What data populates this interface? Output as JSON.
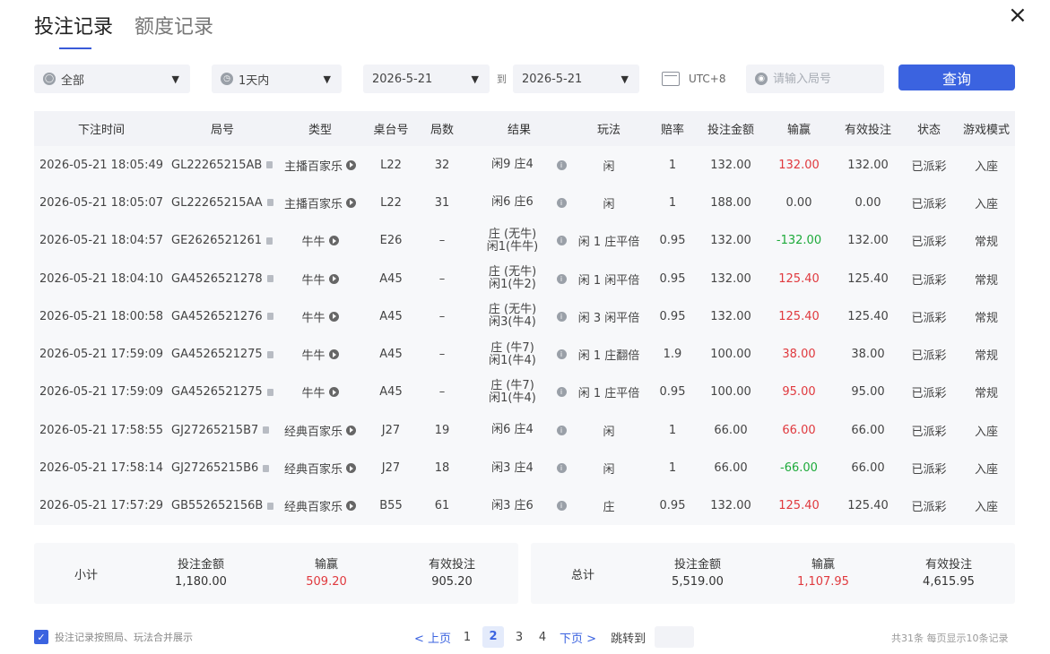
{
  "tabs": [
    {
      "label": "投注记录",
      "active": true
    },
    {
      "label": "额度记录",
      "active": false
    }
  ],
  "close_icon": "×",
  "filters": {
    "category": "全部",
    "time_range": "1天内",
    "date_from": "2026-5-21",
    "to_label": "到",
    "date_to": "2026-5-21",
    "timezone": "UTC+8",
    "search_placeholder": "请输入局号",
    "query_button": "查询"
  },
  "columns": [
    "下注时间",
    "局号",
    "类型",
    "桌台号",
    "局数",
    "结果",
    "玩法",
    "赔率",
    "投注金额",
    "输赢",
    "有效投注",
    "状态",
    "游戏模式"
  ],
  "rows": [
    {
      "time": "2026-05-21 18:05:49",
      "id": "GL22265215AB",
      "type": "主播百家乐",
      "table": "L22",
      "round": "32",
      "result_1": "闲9 庄4",
      "result_2": "",
      "play": "闲",
      "odds": "1",
      "amount": "132.00",
      "win": "132.00",
      "win_color": "red",
      "valid": "132.00",
      "status": "已派彩",
      "mode": "入座"
    },
    {
      "time": "2026-05-21 18:05:07",
      "id": "GL22265215AA",
      "type": "主播百家乐",
      "table": "L22",
      "round": "31",
      "result_1": "闲6 庄6",
      "result_2": "",
      "play": "闲",
      "odds": "1",
      "amount": "188.00",
      "win": "0.00",
      "win_color": "normal",
      "valid": "0.00",
      "status": "已派彩",
      "mode": "入座"
    },
    {
      "time": "2026-05-21 18:04:57",
      "id": "GE2626521261",
      "type": "牛牛",
      "table": "E26",
      "round": "–",
      "result_1": "庄 (无牛)",
      "result_2": "闲1(牛牛)",
      "play": "闲 1 庄平倍",
      "odds": "0.95",
      "amount": "132.00",
      "win": "-132.00",
      "win_color": "green",
      "valid": "132.00",
      "status": "已派彩",
      "mode": "常规"
    },
    {
      "time": "2026-05-21 18:04:10",
      "id": "GA4526521278",
      "type": "牛牛",
      "table": "A45",
      "round": "–",
      "result_1": "庄 (无牛)",
      "result_2": "闲1(牛2)",
      "play": "闲 1 闲平倍",
      "odds": "0.95",
      "amount": "132.00",
      "win": "125.40",
      "win_color": "red",
      "valid": "125.40",
      "status": "已派彩",
      "mode": "常规"
    },
    {
      "time": "2026-05-21 18:00:58",
      "id": "GA4526521276",
      "type": "牛牛",
      "table": "A45",
      "round": "–",
      "result_1": "庄 (无牛)",
      "result_2": "闲3(牛4)",
      "play": "闲 3 闲平倍",
      "odds": "0.95",
      "amount": "132.00",
      "win": "125.40",
      "win_color": "red",
      "valid": "125.40",
      "status": "已派彩",
      "mode": "常规"
    },
    {
      "time": "2026-05-21 17:59:09",
      "id": "GA4526521275",
      "type": "牛牛",
      "table": "A45",
      "round": "–",
      "result_1": "庄 (牛7)",
      "result_2": "闲1(牛4)",
      "play": "闲 1 庄翻倍",
      "odds": "1.9",
      "amount": "100.00",
      "win": "38.00",
      "win_color": "red",
      "valid": "38.00",
      "status": "已派彩",
      "mode": "常规"
    },
    {
      "time": "2026-05-21 17:59:09",
      "id": "GA4526521275",
      "type": "牛牛",
      "table": "A45",
      "round": "–",
      "result_1": "庄 (牛7)",
      "result_2": "闲1(牛4)",
      "play": "闲 1 庄平倍",
      "odds": "0.95",
      "amount": "100.00",
      "win": "95.00",
      "win_color": "red",
      "valid": "95.00",
      "status": "已派彩",
      "mode": "常规"
    },
    {
      "time": "2026-05-21 17:58:55",
      "id": "GJ27265215B7",
      "type": "经典百家乐",
      "table": "J27",
      "round": "19",
      "result_1": "闲6 庄4",
      "result_2": "",
      "play": "闲",
      "odds": "1",
      "amount": "66.00",
      "win": "66.00",
      "win_color": "red",
      "valid": "66.00",
      "status": "已派彩",
      "mode": "入座"
    },
    {
      "time": "2026-05-21 17:58:14",
      "id": "GJ27265215B6",
      "type": "经典百家乐",
      "table": "J27",
      "round": "18",
      "result_1": "闲3 庄4",
      "result_2": "",
      "play": "闲",
      "odds": "1",
      "amount": "66.00",
      "win": "-66.00",
      "win_color": "green",
      "valid": "66.00",
      "status": "已派彩",
      "mode": "入座"
    },
    {
      "time": "2026-05-21 17:57:29",
      "id": "GB552652156B",
      "type": "经典百家乐",
      "table": "B55",
      "round": "61",
      "result_1": "闲3 庄6",
      "result_2": "",
      "play": "庄",
      "odds": "0.95",
      "amount": "132.00",
      "win": "125.40",
      "win_color": "red",
      "valid": "125.40",
      "status": "已派彩",
      "mode": "入座"
    }
  ],
  "subtotal": {
    "label": "小计",
    "amount_label": "投注金额",
    "amount": "1,180.00",
    "win_label": "输赢",
    "win": "509.20",
    "valid_label": "有效投注",
    "valid": "905.20"
  },
  "total": {
    "label": "总计",
    "amount_label": "投注金额",
    "amount": "5,519.00",
    "win_label": "输赢",
    "win": "1,107.95",
    "valid_label": "有效投注",
    "valid": "4,615.95"
  },
  "footer": {
    "merge_label": "投注记录按照局、玩法合并展示",
    "merge_checked": true,
    "prev": "< 上页",
    "pages": [
      "1",
      "2",
      "3",
      "4"
    ],
    "current_page": "2",
    "next": "下页 >",
    "jump_label": "跳转到",
    "record_info": "共31条  每页显示10条记录"
  },
  "colors": {
    "accent": "#3b63e0",
    "positive": "#e0393e",
    "negative": "#1daa3a"
  }
}
